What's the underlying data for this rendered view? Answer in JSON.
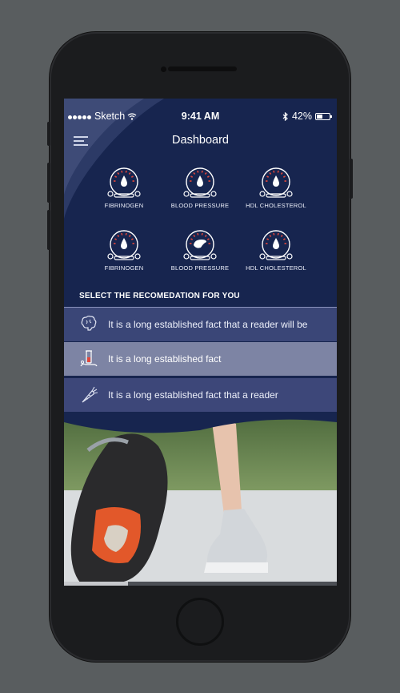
{
  "status_bar": {
    "carrier": "Sketch",
    "time": "9:41 AM",
    "battery_percent": "42%"
  },
  "header": {
    "title": "Dashboard"
  },
  "gauges": [
    {
      "label": "FIBRINOGEN",
      "icon": "drop-icon"
    },
    {
      "label": "BLOOD PRESSURE",
      "icon": "drop-icon"
    },
    {
      "label": "HDL CHOLESTEROL",
      "icon": "drop-icon"
    },
    {
      "label": "FIBRINOGEN",
      "icon": "drop-icon"
    },
    {
      "label": "BLOOD PRESSURE",
      "icon": "liver-icon"
    },
    {
      "label": "HDL CHOLESTEROL",
      "icon": "drop-icon"
    }
  ],
  "recommendations": {
    "title": "SELECT THE RECOMEDATION FOR YOU",
    "items": [
      {
        "text": "It is a long established fact that a reader will be",
        "icon": "brain-icon"
      },
      {
        "text": "It is a long established fact",
        "icon": "lab-tube-icon",
        "selected": true
      },
      {
        "text": "It is a long established fact that a reader",
        "icon": "carrot-icon"
      }
    ]
  },
  "colors": {
    "background": "#17254f",
    "selected_row": "#7d84a4",
    "row": "#3a4677",
    "gauge_tick_red": "#e0473c"
  }
}
